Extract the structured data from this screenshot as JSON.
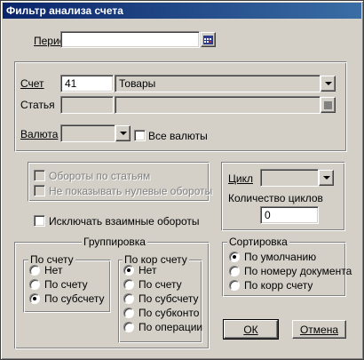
{
  "window": {
    "title": "Фильтр анализа счета"
  },
  "period": {
    "label": "Период",
    "value": ""
  },
  "account": {
    "label": "Счет",
    "code": "41",
    "name": "Товары"
  },
  "article": {
    "label": "Статья",
    "code": "",
    "name": ""
  },
  "currency": {
    "label": "Валюта",
    "value": "",
    "all_label": "Все валюты",
    "all_checked": false
  },
  "turnover_options": {
    "by_articles": "Обороты по статьям",
    "hide_zero": "Не показывать нулевые обороты"
  },
  "cycle": {
    "label": "Цикл",
    "value": "",
    "count_label": "Количество циклов",
    "count_value": "0"
  },
  "exclude_mutual": {
    "label": "Исключать взаимные обороты",
    "checked": false
  },
  "grouping": {
    "title": "Группировка",
    "by_account": {
      "title": "По счету",
      "options": [
        "Нет",
        "По счету",
        "По субсчету"
      ],
      "selected": 2
    },
    "by_corr_account": {
      "title": "По кор счету",
      "options": [
        "Нет",
        "По счету",
        "По субсчету",
        "По субконто",
        "По операции"
      ],
      "selected": 0
    }
  },
  "sorting": {
    "title": "Сортировка",
    "options": [
      "По умолчанию",
      "По номеру документа",
      "По корр счету"
    ],
    "selected": 0
  },
  "buttons": {
    "ok": "ОК",
    "cancel": "Отмена"
  },
  "colors": {
    "titlebar_start": "#0a246a",
    "titlebar_end": "#3a6ea5",
    "face": "#d4d0c8"
  }
}
